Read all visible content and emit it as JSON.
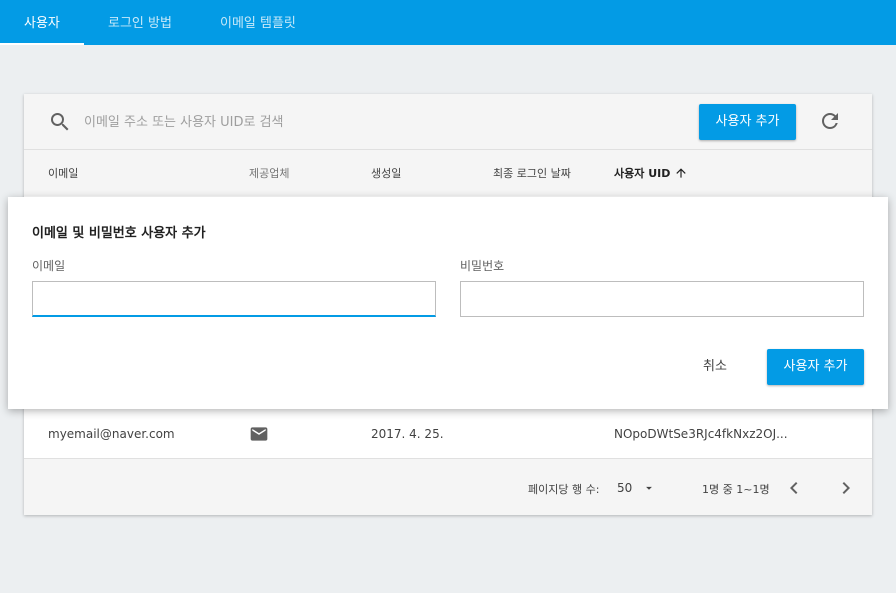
{
  "tabs": [
    {
      "label": "사용자"
    },
    {
      "label": "로그인 방법"
    },
    {
      "label": "이메일 템플릿"
    }
  ],
  "colors": {
    "accent": "#039be5",
    "background": "#eceff1"
  },
  "toolbar": {
    "search_placeholder": "이메일 주소 또는 사용자 UID로 검색",
    "add_user_label": "사용자 추가",
    "search_icon": "search-icon",
    "refresh_icon": "refresh-icon"
  },
  "table": {
    "headers": [
      "이메일",
      "제공업체",
      "생성일",
      "최종 로그인 날짜",
      "사용자 UID"
    ],
    "sort_icon": "arrow-up-icon",
    "rows": [
      {
        "email": "myemail@naver.com",
        "provider_icon": "mail-icon",
        "created": "2017. 4. 25.",
        "last_login": "",
        "uid": "NOpoDWtSe3RJc4fkNxz2OJ..."
      }
    ]
  },
  "footer": {
    "rows_per_page_label": "페이지당 행 수:",
    "rows_per_page_value": "50",
    "range_text": "1명 중 1~1명"
  },
  "dialog": {
    "title": "이메일 및 비밀번호 사용자 추가",
    "email_label": "이메일",
    "password_label": "비밀번호",
    "email_value": "",
    "password_value": "",
    "cancel_label": "취소",
    "submit_label": "사용자 추가"
  }
}
